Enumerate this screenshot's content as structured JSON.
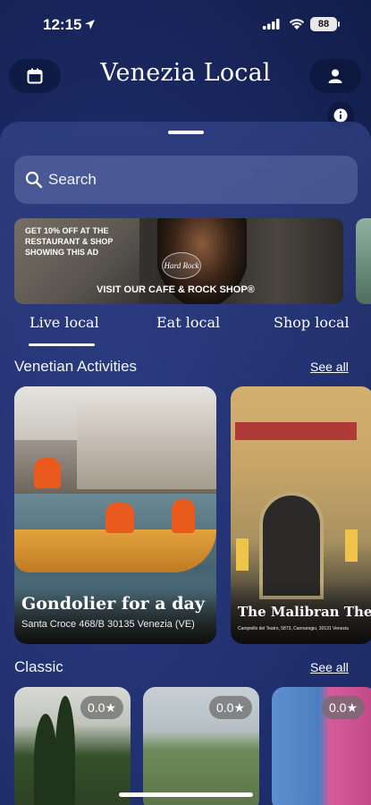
{
  "status_bar": {
    "time": "12:15",
    "battery": "88"
  },
  "header": {
    "title": "Venezia Local"
  },
  "search": {
    "placeholder": "Search"
  },
  "banner": {
    "promo_text": "GET 10% OFF AT THE RESTAURANT & SHOP SHOWING THIS AD",
    "logo_text": "Hard Rock",
    "cta_text": "VISIT OUR CAFE & ROCK SHOP®"
  },
  "tabs": [
    {
      "label": "Live local",
      "active": true
    },
    {
      "label": "Eat local",
      "active": false
    },
    {
      "label": "Shop local",
      "active": false
    }
  ],
  "sections": {
    "activities": {
      "title": "Venetian Activities",
      "see_all": "See all",
      "cards": [
        {
          "title": "Gondolier for a day",
          "subtitle": "Santa Croce 468/B 30135 Venezia (VE)"
        },
        {
          "title": "The Malibran Theatre",
          "subtitle": "Campiello del Teatro, 5873, Cannaregio, 30131 Venezia"
        }
      ]
    },
    "classic": {
      "title": "Classic",
      "see_all": "See all",
      "cards": [
        {
          "rating": "0.0★"
        },
        {
          "rating": "0.0★"
        },
        {
          "rating": "0.0★"
        }
      ]
    }
  },
  "colors": {
    "background": "#1c2b66",
    "sheet": "#3a4e96",
    "accent": "#ffffff"
  }
}
